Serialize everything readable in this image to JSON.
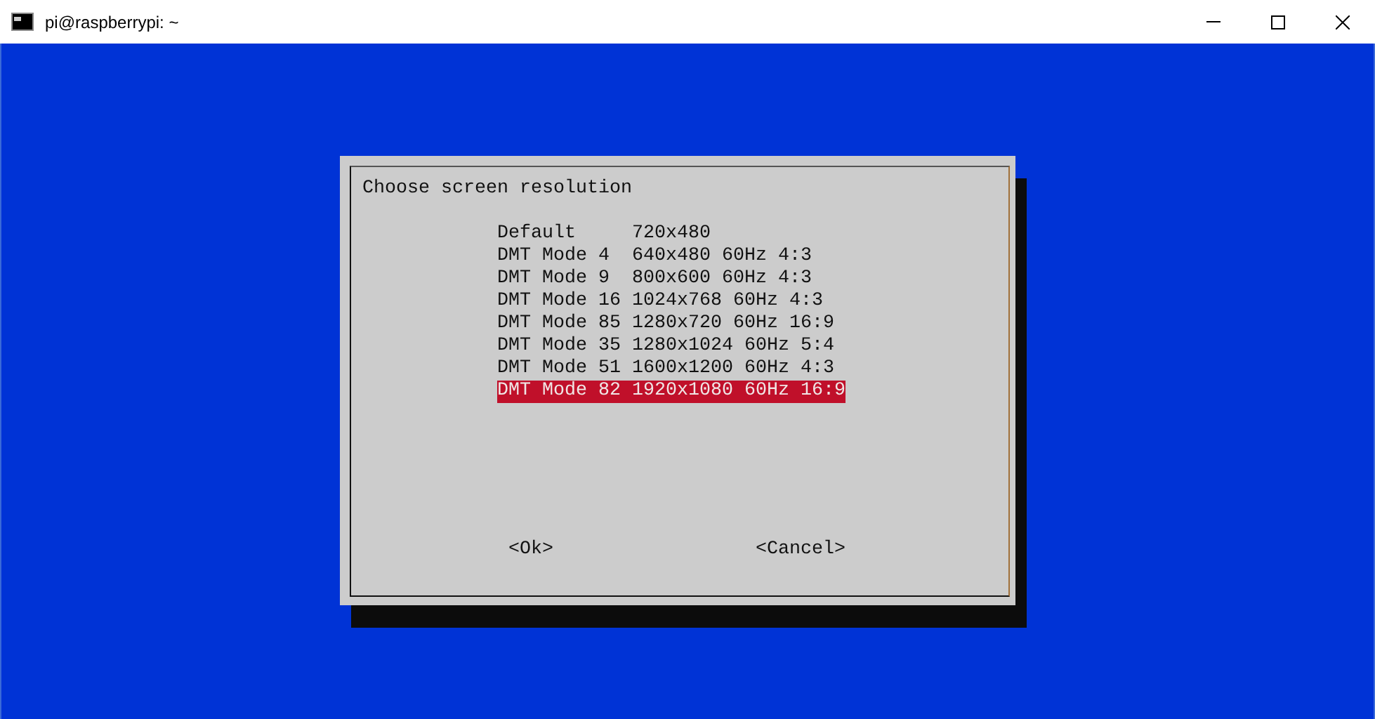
{
  "window": {
    "title": "pi@raspberrypi: ~"
  },
  "dialog": {
    "title": "Choose screen resolution",
    "options": [
      {
        "label": "Default     720x480",
        "selected": false
      },
      {
        "label": "DMT Mode 4  640x480 60Hz 4:3",
        "selected": false
      },
      {
        "label": "DMT Mode 9  800x600 60Hz 4:3",
        "selected": false
      },
      {
        "label": "DMT Mode 16 1024x768 60Hz 4:3",
        "selected": false
      },
      {
        "label": "DMT Mode 85 1280x720 60Hz 16:9",
        "selected": false
      },
      {
        "label": "DMT Mode 35 1280x1024 60Hz 5:4",
        "selected": false
      },
      {
        "label": "DMT Mode 51 1600x1200 60Hz 4:3",
        "selected": false
      },
      {
        "label": "DMT Mode 82 1920x1080 60Hz 16:9",
        "selected": true
      }
    ],
    "buttons": [
      "<Ok>",
      "<Cancel>"
    ]
  }
}
